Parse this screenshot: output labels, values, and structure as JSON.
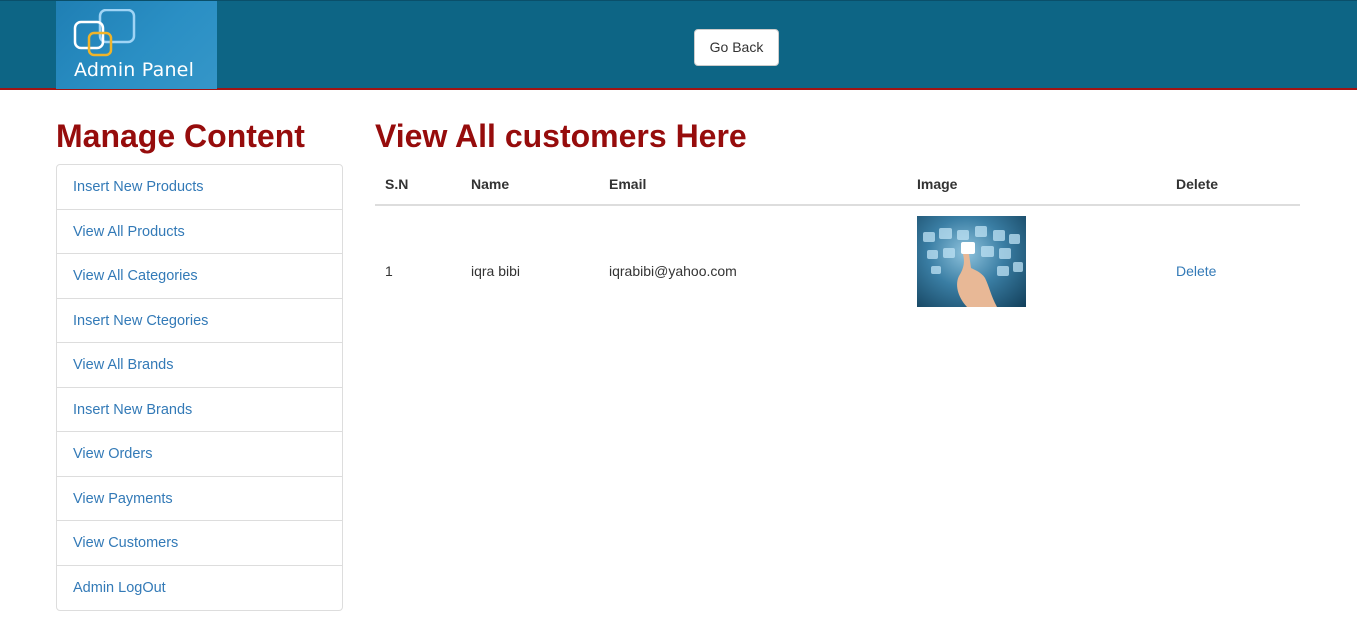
{
  "header": {
    "logo_text": "Admin Panel",
    "go_back_label": "Go Back"
  },
  "sidebar": {
    "title": "Manage Content",
    "items": [
      {
        "label": "Insert New Products"
      },
      {
        "label": "View All Products"
      },
      {
        "label": "View All Categories"
      },
      {
        "label": "Insert New Ctegories"
      },
      {
        "label": "View All Brands"
      },
      {
        "label": "Insert New Brands"
      },
      {
        "label": "View Orders"
      },
      {
        "label": "View Payments"
      },
      {
        "label": "View Customers"
      },
      {
        "label": "Admin LogOut"
      }
    ]
  },
  "main": {
    "title": "View All customers Here",
    "columns": [
      "S.N",
      "Name",
      "Email",
      "Image",
      "Delete"
    ],
    "rows": [
      {
        "sn": "1",
        "name": "iqra bibi",
        "email": "iqrabibi@yahoo.com",
        "image_icon": "customer-photo-icon",
        "delete_label": "Delete"
      }
    ]
  },
  "colors": {
    "header_bg": "#0d6585",
    "header_border": "#a01414",
    "title_red": "#960c0c",
    "link_blue": "#337ab7"
  }
}
